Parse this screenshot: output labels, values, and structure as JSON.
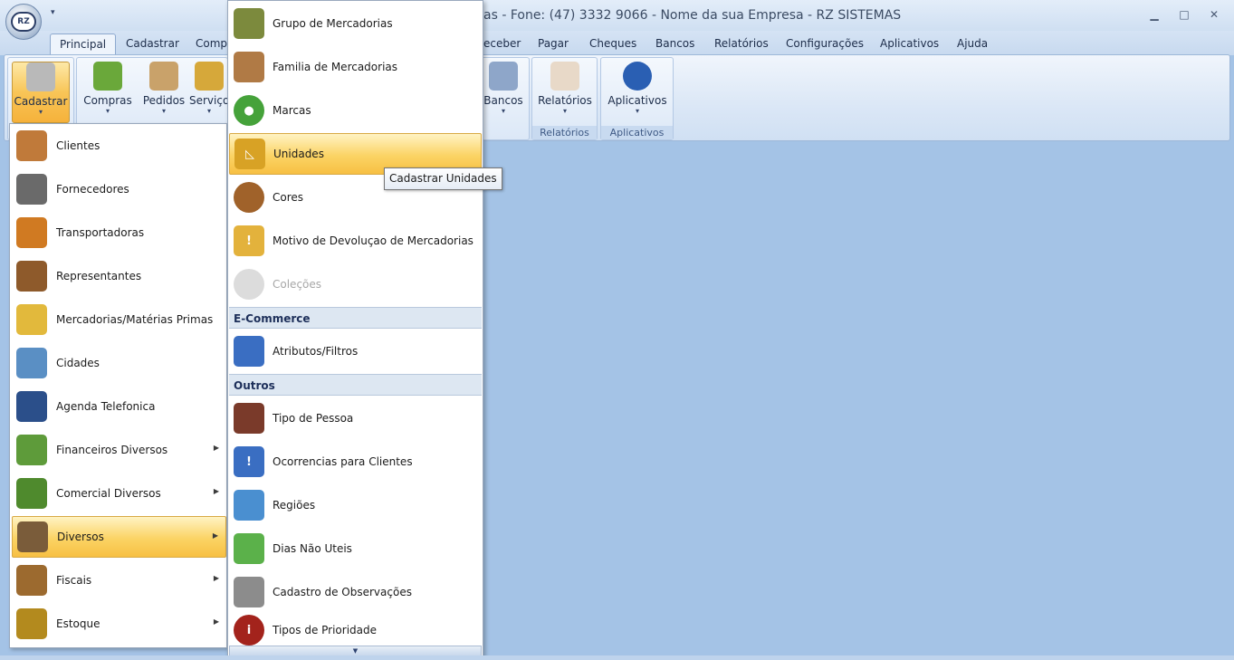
{
  "window": {
    "title": "as - Fone: (47) 3332 9066 - Nome da sua Empresa - RZ SISTEMAS",
    "app_logo": "RZ",
    "minimize": "▁",
    "maximize": "□",
    "close": "✕"
  },
  "tabs": [
    "Principal",
    "Cadastrar",
    "Comp",
    "eceber",
    "Pagar",
    "Cheques",
    "Bancos",
    "Relatórios",
    "Configurações",
    "Aplicativos",
    "Ajuda"
  ],
  "ribbon": {
    "buttons": {
      "cadastrar": "Cadastrar",
      "compras": "Compras",
      "pedidos": "Pedidos",
      "servicos": "Serviço",
      "bancos": "Bancos",
      "relatorios": "Relatórios",
      "aplicativos": "Aplicativos"
    },
    "groups": {
      "relatorios": "Relatórios",
      "aplicativos": "Aplicativos"
    },
    "dropdown_glyph": "▾"
  },
  "cadastrar_menu": [
    {
      "label": "Clientes",
      "icon": "people-icon",
      "color": "#c07a3a"
    },
    {
      "label": "Fornecedores",
      "icon": "supplier-icon",
      "color": "#6a6a6a"
    },
    {
      "label": "Transportadoras",
      "icon": "truck-icon",
      "color": "#d07a22"
    },
    {
      "label": "Representantes",
      "icon": "briefcase-icon",
      "color": "#8e5a2b"
    },
    {
      "label": "Mercadorias/Matérias Primas",
      "icon": "box-icon",
      "color": "#e2b93c"
    },
    {
      "label": "Cidades",
      "icon": "buildings-icon",
      "color": "#5a8fc4"
    },
    {
      "label": "Agenda Telefonica",
      "icon": "phonebook-icon",
      "color": "#2b4f8a"
    },
    {
      "label": "Financeiros Diversos",
      "icon": "finance-icon",
      "color": "#5e9b3a"
    },
    {
      "label": "Comercial Diversos",
      "icon": "basket-icon",
      "color": "#4f8a2d"
    },
    {
      "label": "Diversos",
      "icon": "books-icon",
      "color": "#7a5c3a"
    },
    {
      "label": "Fiscais",
      "icon": "scales-icon",
      "color": "#9c6a2f"
    },
    {
      "label": "Estoque",
      "icon": "forklift-icon",
      "color": "#b38a1e"
    }
  ],
  "diversos_menu": {
    "top_items": [
      {
        "label": "Grupo de Mercadorias",
        "icon": "boxes-icon",
        "color": "#7c8a3d"
      },
      {
        "label": "Familia de Mercadorias",
        "icon": "box-open-icon",
        "color": "#b07a45"
      },
      {
        "label": "Marcas",
        "icon": "tag-icon",
        "color": "#45a23a",
        "glyph": "●"
      },
      {
        "label": "Unidades",
        "icon": "triangle-ruler-icon",
        "color": "#d8a225",
        "glyph": "◺"
      },
      {
        "label": "Cores",
        "icon": "palette-icon",
        "color": "#a0622a"
      },
      {
        "label": "Motivo de Devoluçao de Mercadorias",
        "icon": "return-box-icon",
        "color": "#e3b23c",
        "glyph": "!"
      },
      {
        "label": "Coleções",
        "icon": "collections-icon",
        "color": "#9a9a9a"
      }
    ],
    "ecommerce_header": "E-Commerce",
    "ecommerce_items": [
      {
        "label": "Atributos/Filtros",
        "icon": "cart-filter-icon",
        "color": "#3a6ec2"
      }
    ],
    "outros_header": "Outros",
    "outros_items": [
      {
        "label": "Tipo de Pessoa",
        "icon": "persons-icon",
        "color": "#7a3a2a"
      },
      {
        "label": "Ocorrencias para Clientes",
        "icon": "client-alert-icon",
        "color": "#3a6ec2",
        "glyph": "!"
      },
      {
        "label": "Regiões",
        "icon": "map-icon",
        "color": "#4a8fd0"
      },
      {
        "label": "Dias Não Uteis",
        "icon": "calendar-icon",
        "color": "#5bb14a"
      },
      {
        "label": "Cadastro de Observações",
        "icon": "notepad-icon",
        "color": "#8c8c8c"
      },
      {
        "label": "Tipos de Prioridade",
        "icon": "priority-icon",
        "color": "#a3231c",
        "glyph": "i"
      }
    ],
    "scroll_glyph": "▼"
  },
  "tooltip": "Cadastrar Unidades",
  "submenu_arrow": "▶"
}
